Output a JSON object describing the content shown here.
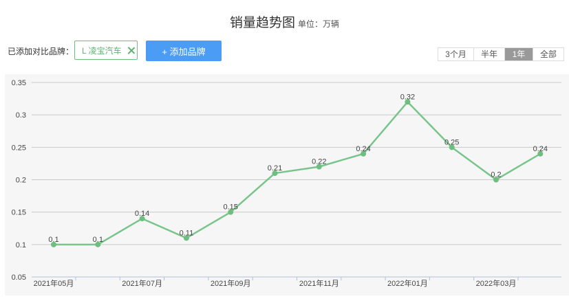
{
  "header": {
    "title": "销量趋势图",
    "unit": "单位：万辆"
  },
  "compare": {
    "label": "已添加对比品牌：",
    "brand_tag": "L 凌宝汽车",
    "add_button": "+ 添加品牌"
  },
  "range_tabs": [
    {
      "label": "3个月",
      "active": false
    },
    {
      "label": "半年",
      "active": false
    },
    {
      "label": "1年",
      "active": true
    },
    {
      "label": "全部",
      "active": false
    }
  ],
  "colors": {
    "line": "#78c58b",
    "point": "#6cbf7e",
    "accent": "#4b9cf4",
    "grid": "#c8c8c8",
    "axis": "#a9c3dc"
  },
  "chart_data": {
    "type": "line",
    "x": [
      "2021年05月",
      "2021年06月",
      "2021年07月",
      "2021年08月",
      "2021年09月",
      "2021年10月",
      "2021年11月",
      "2021年12月",
      "2022年01月",
      "2022年02月",
      "2022年03月",
      "2022年04月"
    ],
    "x_tick_labels": [
      "2021年05月",
      "2021年07月",
      "2021年09月",
      "2021年11月",
      "2022年01月",
      "2022年03月"
    ],
    "series": [
      {
        "values": [
          0.1,
          0.1,
          0.14,
          0.11,
          0.15,
          0.21,
          0.22,
          0.24,
          0.32,
          0.25,
          0.2,
          0.24
        ]
      }
    ],
    "data_labels": [
      "0.1",
      "0.1",
      "0.14",
      "0.11",
      "0.15",
      "0.21",
      "0.22",
      "0.24",
      "0.32",
      "0.25",
      "0.2",
      "0.24"
    ],
    "y_ticks": [
      "0.05",
      "0.1",
      "0.15",
      "0.2",
      "0.25",
      "0.3",
      "0.35"
    ],
    "ylim": [
      0.05,
      0.35
    ],
    "grid": true,
    "legend": "none"
  }
}
